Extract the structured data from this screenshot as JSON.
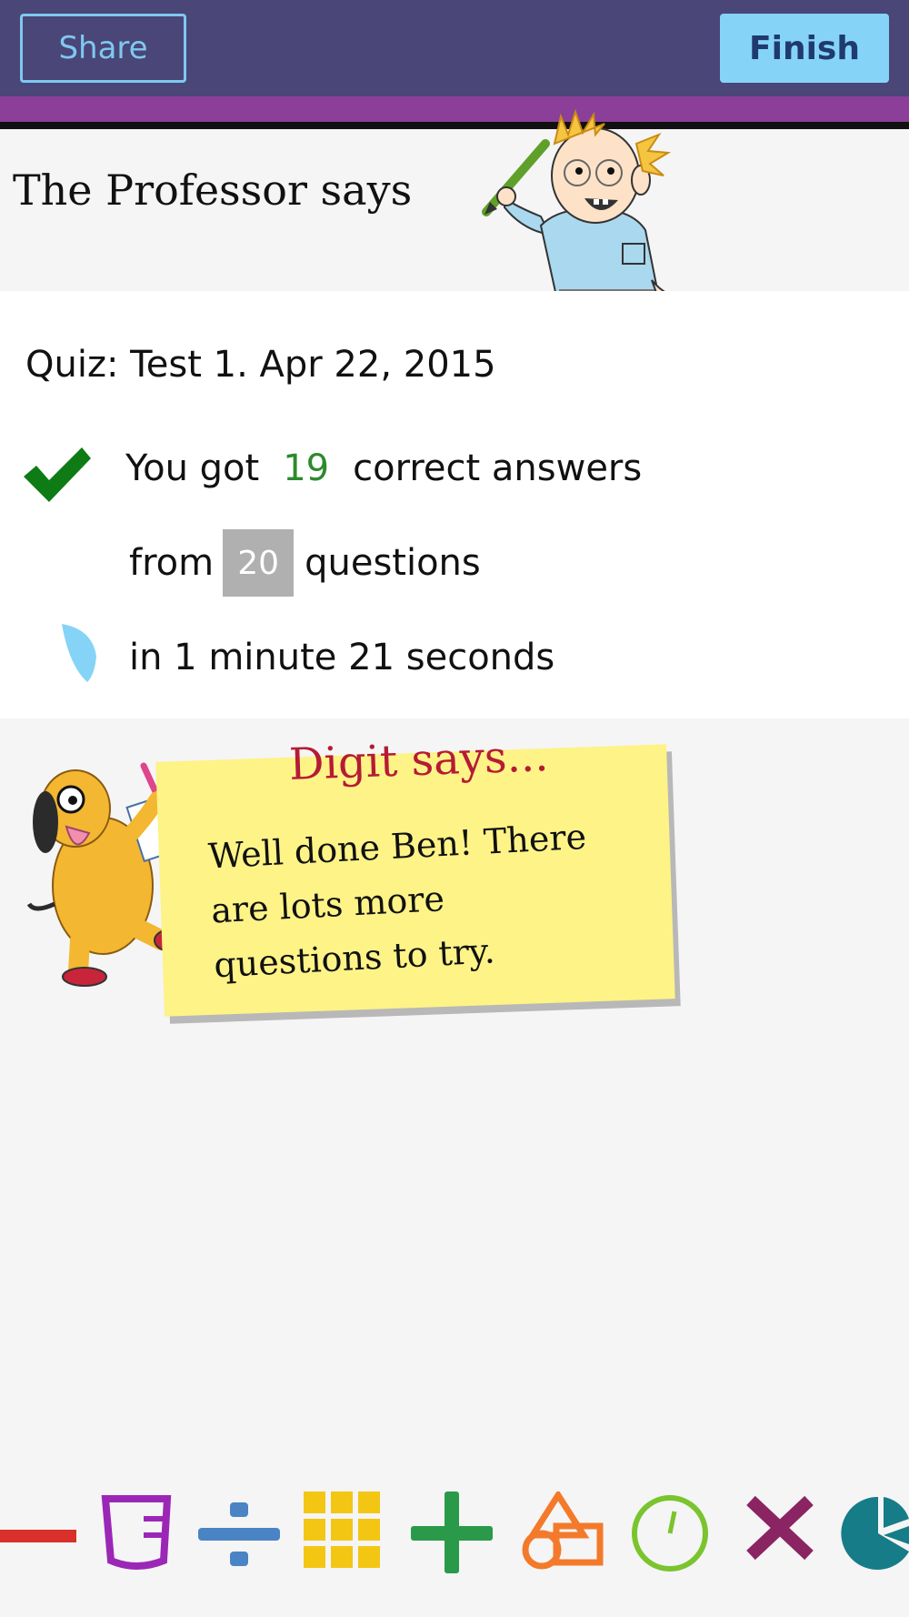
{
  "topbar": {
    "share_label": "Share",
    "finish_label": "Finish",
    "colors": {
      "bar": "#4a4678",
      "strip": "#8b3f99",
      "finish_bg": "#85d4f8",
      "share_border": "#7fc8f0"
    }
  },
  "professor": {
    "title": "The Professor says"
  },
  "results": {
    "quiz_title": "Quiz: Test 1. Apr 22, 2015",
    "correct_prefix": "You got",
    "correct_count": "19",
    "correct_suffix": "correct answers",
    "from_prefix": "from",
    "total_questions": "20",
    "from_suffix": "questions",
    "time_text": "in 1 minute 21 seconds",
    "icons": [
      "check-icon",
      "clock-icon"
    ]
  },
  "digit": {
    "title": "Digit says...",
    "message": "Well done Ben! There are lots more questions to try."
  },
  "bottom_icons": [
    "minus-icon",
    "measuring-cup-icon",
    "divide-icon",
    "grid-icon",
    "plus-icon",
    "shapes-icon",
    "clock-icon",
    "multiply-icon",
    "pie-chart-icon"
  ]
}
